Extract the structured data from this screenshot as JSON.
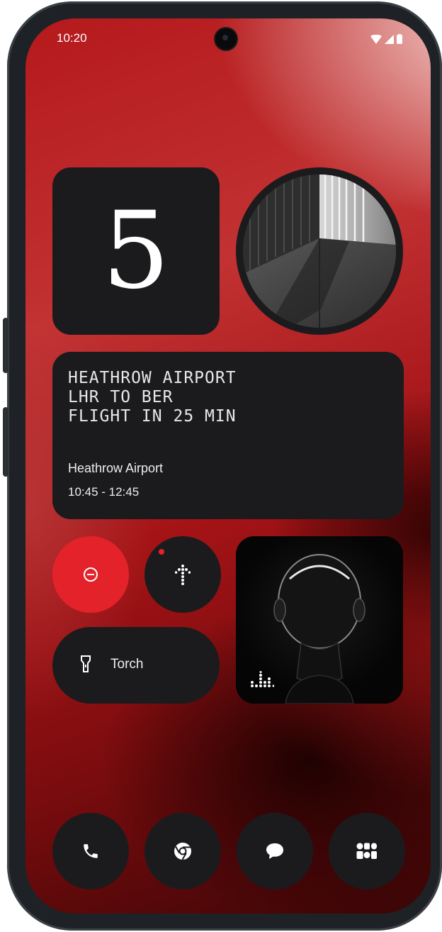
{
  "status_bar": {
    "time": "10:20",
    "icons": [
      "wifi-icon",
      "signal-icon",
      "battery-icon"
    ]
  },
  "widgets": {
    "counter": {
      "value": "5"
    },
    "flight": {
      "dot_lines": [
        "HEATHROW AIRPORT",
        "LHR TO BER",
        "FLIGHT IN 25 MIN"
      ],
      "location": "Heathrow Airport",
      "time_range": "10:45  - 12:45"
    },
    "quick_toggles": {
      "dnd_icon": "minus-circle-icon",
      "nav_icon": "dot-arrow-icon",
      "torch_label": "Torch",
      "torch_icon": "flashlight-icon"
    },
    "music": {
      "icon": "equalizer-icon"
    }
  },
  "dock": {
    "apps": [
      "phone-icon",
      "chrome-icon",
      "messages-icon",
      "apps-grid-icon"
    ]
  },
  "colors": {
    "accent_red": "#e4222a",
    "widget_bg": "#1b1b1e"
  }
}
